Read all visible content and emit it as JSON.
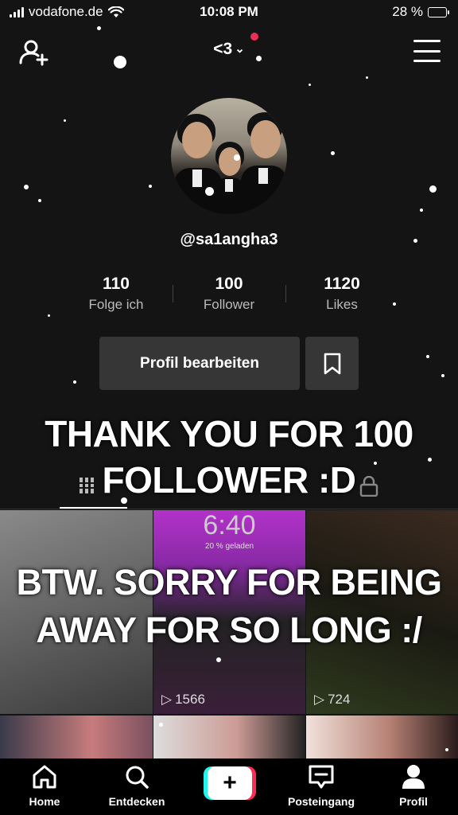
{
  "status_bar": {
    "carrier": "vodafone.de",
    "time": "10:08 PM",
    "battery": "28 %",
    "battery_level": 0.28
  },
  "top_nav": {
    "account_name": "<3",
    "icons": [
      "add-user-icon",
      "chevron-down-icon",
      "menu-icon"
    ]
  },
  "profile": {
    "username": "@sa1angha3",
    "stats": [
      {
        "value": "110",
        "label": "Folge ich"
      },
      {
        "value": "100",
        "label": "Follower"
      },
      {
        "value": "1120",
        "label": "Likes"
      }
    ],
    "edit_button": "Profil bearbeiten"
  },
  "tabs": {
    "icons": [
      "grid-icon",
      "lock-icon"
    ]
  },
  "videos": [
    {
      "views": ""
    },
    {
      "views": "1566",
      "lockscreen_time": "6:40",
      "lockscreen_sub": "20 % geladen"
    },
    {
      "views": "724"
    },
    {
      "views": ""
    },
    {
      "views": ""
    },
    {
      "views": ""
    }
  ],
  "overlay": {
    "line1": "THANK YOU FOR 100",
    "line2": "FOLLOWER :D",
    "line3": "BTW. SORRY FOR BEING",
    "line4": "AWAY FOR SO LONG :/"
  },
  "bottom_nav": {
    "items": [
      {
        "label": "Home",
        "icon": "home-icon"
      },
      {
        "label": "Entdecken",
        "icon": "search-icon"
      },
      {
        "label": "",
        "icon": "plus-icon"
      },
      {
        "label": "Posteingang",
        "icon": "inbox-icon"
      },
      {
        "label": "Profil",
        "icon": "profile-icon"
      }
    ]
  },
  "colors": {
    "background": "#141414",
    "button": "#363636",
    "notification_dot": "#ee2c58",
    "tiktok_cyan": "#25f4ee",
    "tiktok_red": "#fe2c55"
  }
}
